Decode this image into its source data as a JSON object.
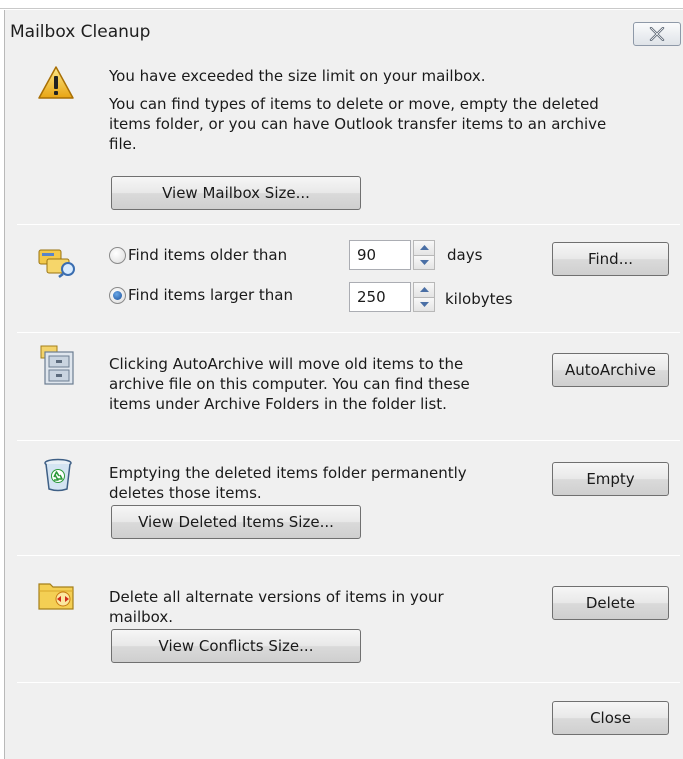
{
  "window": {
    "title": "Mailbox Cleanup",
    "close_glyph": "X"
  },
  "size_section": {
    "warning": "You have exceeded the size limit on your mailbox.",
    "description": [
      "You can find types of items to delete or move, empty the deleted",
      "items folder, or you can have Outlook transfer items to an archive",
      "file."
    ],
    "view_size_button": "View Mailbox Size..."
  },
  "find_section": {
    "older": {
      "label": "Find items older than",
      "value": "90",
      "unit": "days",
      "checked": false
    },
    "larger": {
      "label": "Find items larger than",
      "value": "250",
      "unit": "kilobytes",
      "checked": true
    },
    "find_button": "Find..."
  },
  "autoarchive_section": {
    "description": [
      "Clicking AutoArchive will move old items to the",
      "archive file on this computer. You can find these",
      "items under Archive Folders in the folder list."
    ],
    "button": "AutoArchive"
  },
  "deleted_section": {
    "description": [
      "Emptying the deleted items folder permanently",
      "deletes those items."
    ],
    "empty_button": "Empty",
    "view_size_button": "View Deleted Items Size..."
  },
  "conflicts_section": {
    "description": [
      "Delete all alternate versions of items in your",
      "mailbox."
    ],
    "delete_button": "Delete",
    "view_size_button": "View Conflicts Size..."
  },
  "footer": {
    "close_button": "Close"
  },
  "icons": {
    "warning": "warning-triangle-icon",
    "find": "find-items-icon",
    "archive": "archive-cabinet-icon",
    "recycle": "recycle-bin-icon",
    "conflicts": "conflicts-folder-icon"
  }
}
